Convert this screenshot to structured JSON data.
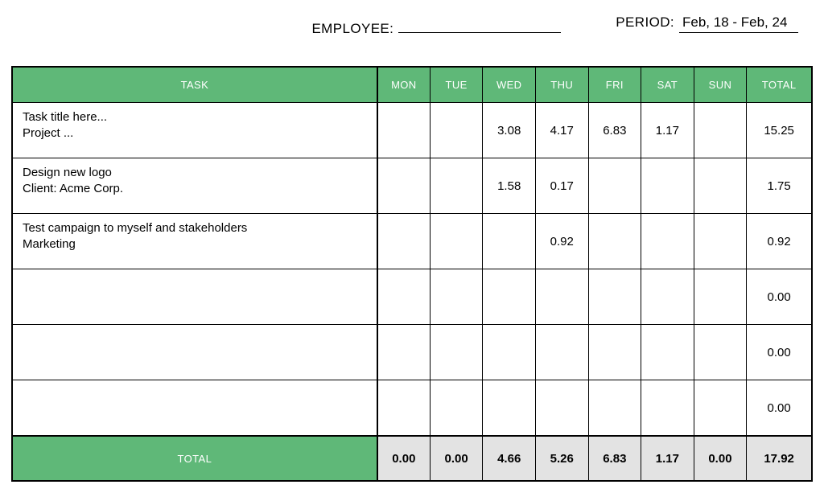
{
  "meta": {
    "employee_label": "EMPLOYEE:",
    "employee_value": "",
    "period_label": "PERIOD:",
    "period_value": "Feb, 18 - Feb, 24"
  },
  "table": {
    "headers": {
      "task": "TASK",
      "mon": "MON",
      "tue": "TUE",
      "wed": "WED",
      "thu": "THU",
      "fri": "FRI",
      "sat": "SAT",
      "sun": "SUN",
      "total": "TOTAL"
    },
    "rows": [
      {
        "task_line1": "Task title here...",
        "task_line2": "Project ...",
        "mon": "",
        "tue": "",
        "wed": "3.08",
        "thu": "4.17",
        "fri": "6.83",
        "sat": "1.17",
        "sun": "",
        "total": "15.25"
      },
      {
        "task_line1": "Design new logo",
        "task_line2": "Client: Acme Corp.",
        "mon": "",
        "tue": "",
        "wed": "1.58",
        "thu": "0.17",
        "fri": "",
        "sat": "",
        "sun": "",
        "total": "1.75"
      },
      {
        "task_line1": "Test campaign to myself and stakeholders",
        "task_line2": "Marketing",
        "mon": "",
        "tue": "",
        "wed": "",
        "thu": "0.92",
        "fri": "",
        "sat": "",
        "sun": "",
        "total": "0.92"
      },
      {
        "task_line1": "",
        "task_line2": "",
        "mon": "",
        "tue": "",
        "wed": "",
        "thu": "",
        "fri": "",
        "sat": "",
        "sun": "",
        "total": "0.00"
      },
      {
        "task_line1": "",
        "task_line2": "",
        "mon": "",
        "tue": "",
        "wed": "",
        "thu": "",
        "fri": "",
        "sat": "",
        "sun": "",
        "total": "0.00"
      },
      {
        "task_line1": "",
        "task_line2": "",
        "mon": "",
        "tue": "",
        "wed": "",
        "thu": "",
        "fri": "",
        "sat": "",
        "sun": "",
        "total": "0.00"
      }
    ],
    "footer": {
      "label": "TOTAL",
      "mon": "0.00",
      "tue": "0.00",
      "wed": "4.66",
      "thu": "5.26",
      "fri": "6.83",
      "sat": "1.17",
      "sun": "0.00",
      "total": "17.92"
    }
  }
}
